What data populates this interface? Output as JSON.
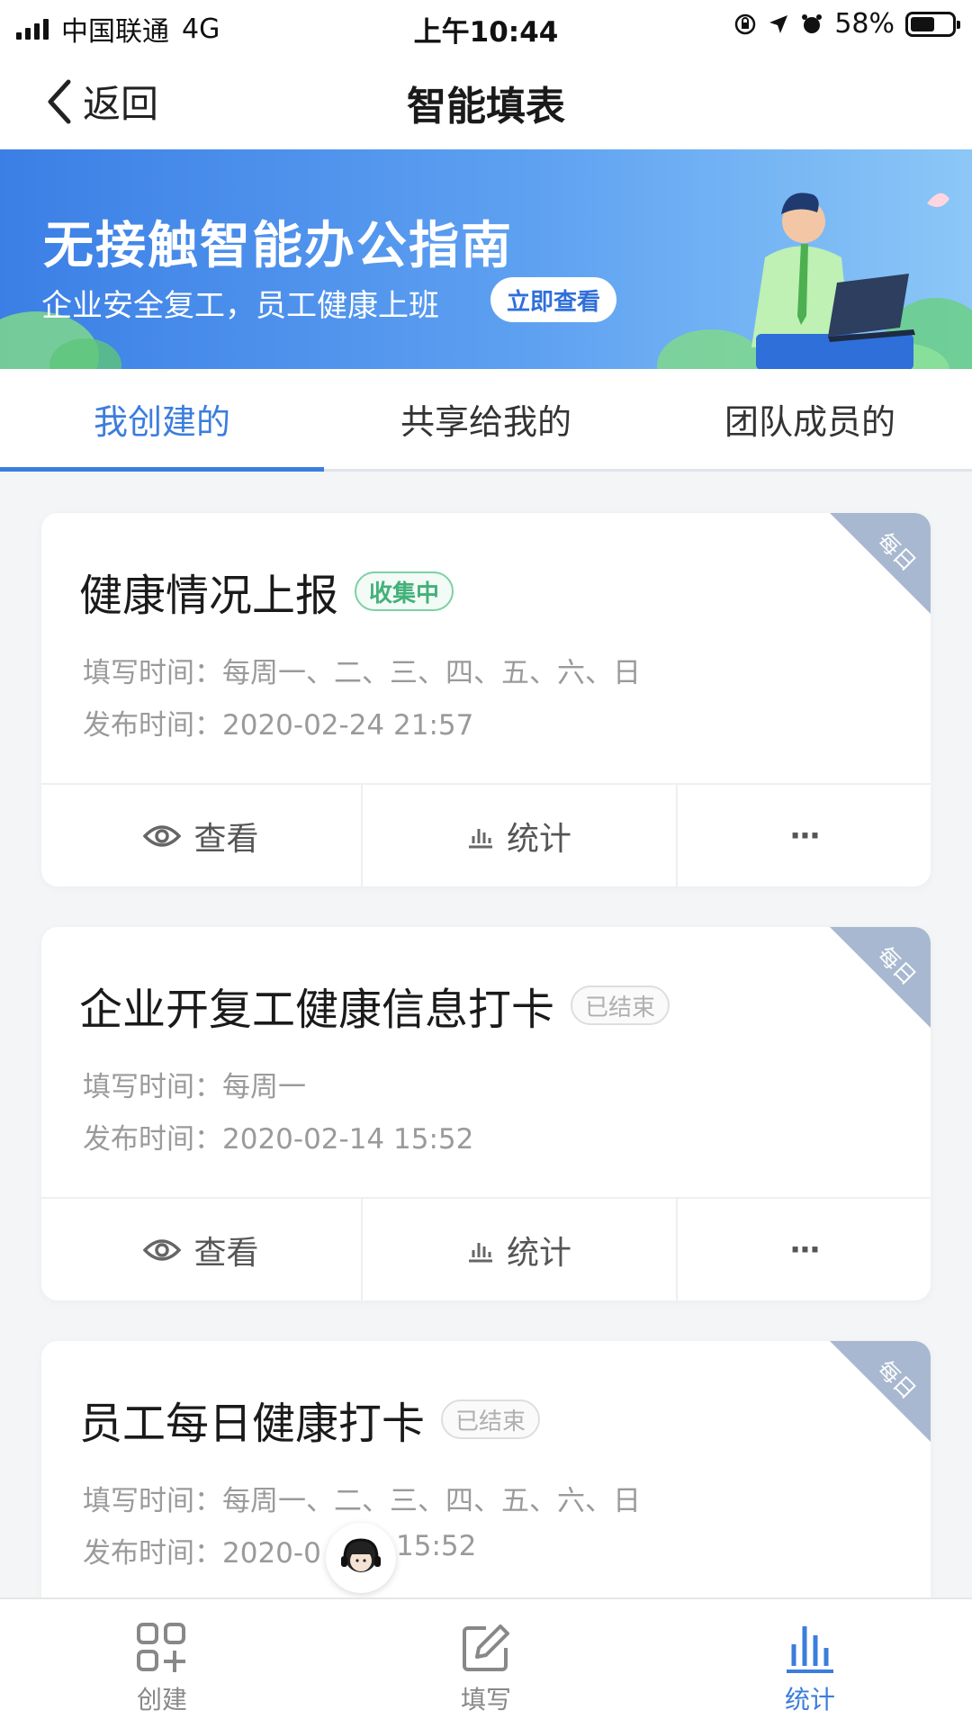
{
  "status_bar": {
    "carrier": "中国联通",
    "network": "4G",
    "time": "上午10:44",
    "battery": "58%"
  },
  "nav": {
    "back_label": "返回",
    "title": "智能填表"
  },
  "banner": {
    "title": "无接触智能办公指南",
    "subtitle": "企业安全复工，员工健康上班",
    "button": "立即查看"
  },
  "tabs": [
    {
      "label": "我创建的",
      "active": true
    },
    {
      "label": "共享给我的",
      "active": false
    },
    {
      "label": "团队成员的",
      "active": false
    }
  ],
  "cards": [
    {
      "title": "健康情况上报",
      "status": "收集中",
      "ribbon": "每日",
      "fill_time": "填写时间：每周一、二、三、四、五、六、日",
      "publish_time": "发布时间：2020-02-24 21:57",
      "actions": {
        "view": "查看",
        "stats": "统计",
        "more": "···"
      }
    },
    {
      "title": "企业开复工健康信息打卡",
      "status": "已结束",
      "ribbon": "每日",
      "fill_time": "填写时间：每周一",
      "publish_time": "发布时间：2020-02-14 15:52",
      "actions": {
        "view": "查看",
        "stats": "统计",
        "more": "···"
      }
    },
    {
      "title": "员工每日健康打卡",
      "status": "已结束",
      "ribbon": "每日",
      "fill_time": "填写时间：每周一、二、三、四、五、六、日",
      "publish_time": "发布时间：2020-0",
      "publish_time_tail": "15:52"
    }
  ],
  "bottom_nav": [
    {
      "label": "创建",
      "icon": "grid-plus-icon",
      "active": false
    },
    {
      "label": "填写",
      "icon": "edit-icon",
      "active": false
    },
    {
      "label": "统计",
      "icon": "bar-chart-icon",
      "active": true
    }
  ],
  "colors": {
    "accent": "#3b7ddd",
    "collecting": "#43b17a",
    "ribbon": "#a8b8d0"
  }
}
